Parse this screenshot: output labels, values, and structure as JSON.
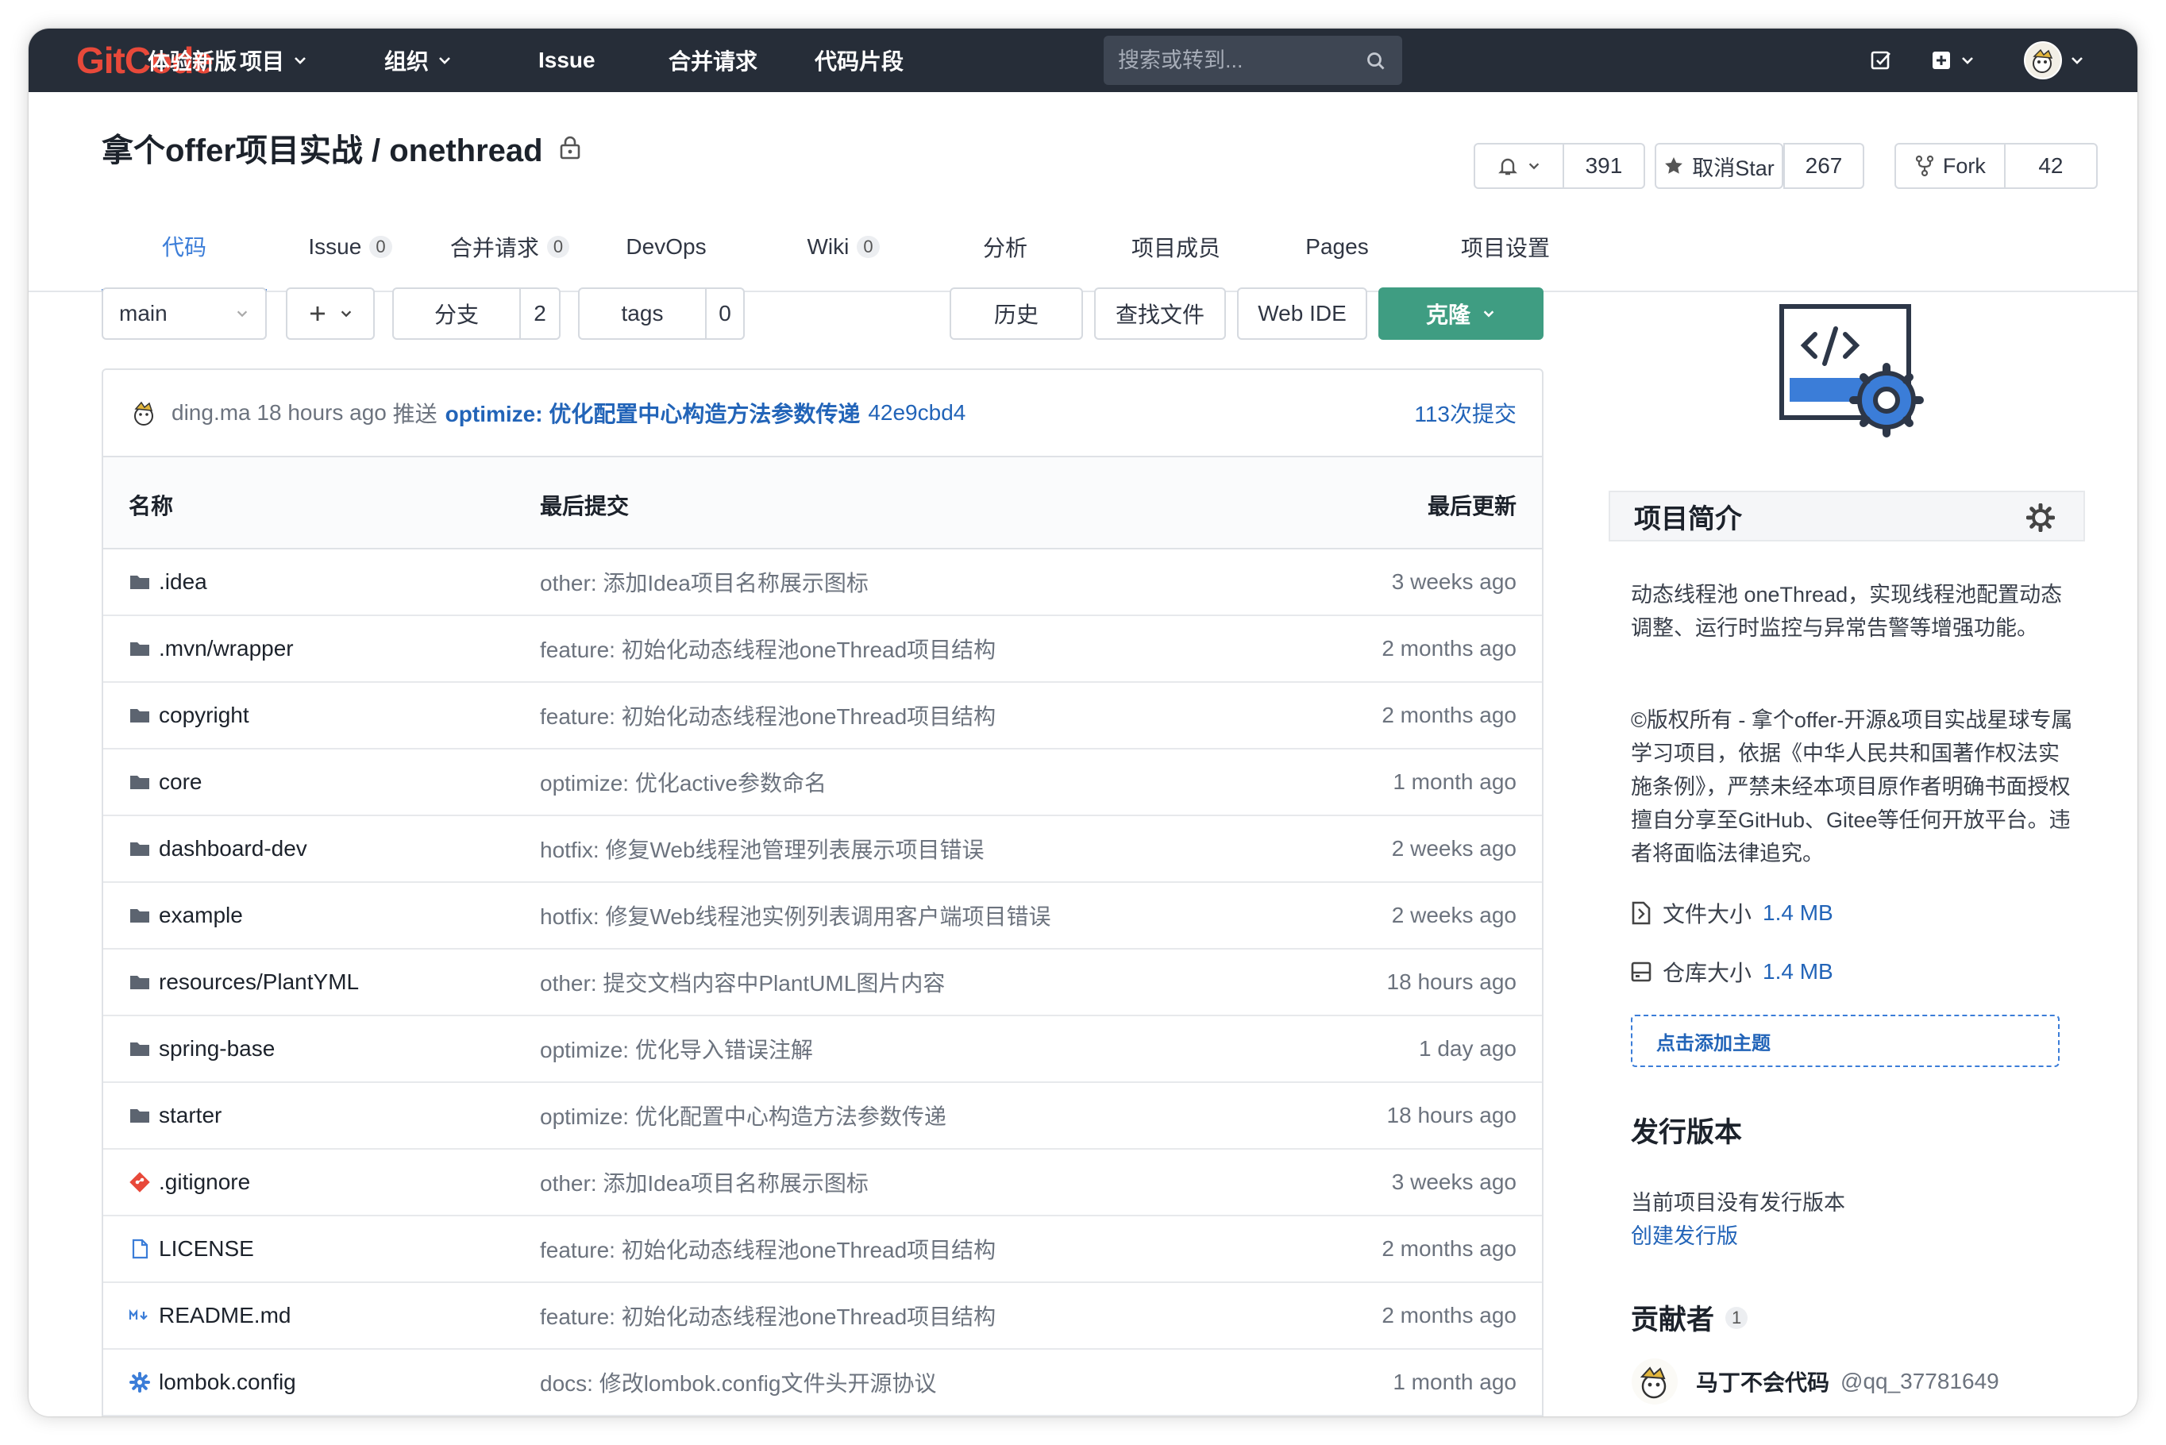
{
  "nav": {
    "logo_text": "GitCode",
    "items": [
      "体验新版",
      "项目",
      "组织",
      "Issue",
      "合并请求",
      "代码片段"
    ],
    "search_placeholder": "搜索或转到..."
  },
  "repo": {
    "namespace": "拿个offer项目实战",
    "separator": " / ",
    "name": "onethread",
    "watch_count": "391",
    "star_label": "取消Star",
    "star_count": "267",
    "fork_label": "Fork",
    "fork_count": "42"
  },
  "tabs": [
    {
      "label": "代码",
      "badge": ""
    },
    {
      "label": "Issue",
      "badge": "0"
    },
    {
      "label": "合并请求",
      "badge": "0"
    },
    {
      "label": "DevOps",
      "badge": ""
    },
    {
      "label": "Wiki",
      "badge": "0"
    },
    {
      "label": "分析",
      "badge": ""
    },
    {
      "label": "项目成员",
      "badge": ""
    },
    {
      "label": "Pages",
      "badge": ""
    },
    {
      "label": "项目设置",
      "badge": ""
    }
  ],
  "toolbar": {
    "branch": "main",
    "branches_label": "分支",
    "branches_count": "2",
    "tags_label": "tags",
    "tags_count": "0",
    "history": "历史",
    "find_file": "查找文件",
    "web_ide": "Web IDE",
    "clone": "克隆"
  },
  "last_commit": {
    "author": "ding.ma",
    "time": "18 hours ago",
    "action": "推送",
    "message": "optimize: 优化配置中心构造方法参数传递",
    "sha": "42e9cbd4",
    "commit_count": "113次提交"
  },
  "table": {
    "headers": {
      "name": "名称",
      "last_commit": "最后提交",
      "last_update": "最后更新"
    },
    "rows": [
      {
        "name": ".idea",
        "type": "folder",
        "commit": "other: 添加Idea项目名称展示图标",
        "time": "3 weeks ago"
      },
      {
        "name": ".mvn/wrapper",
        "type": "folder",
        "commit": "feature: 初始化动态线程池oneThread项目结构",
        "time": "2 months ago"
      },
      {
        "name": "copyright",
        "type": "folder",
        "commit": "feature: 初始化动态线程池oneThread项目结构",
        "time": "2 months ago"
      },
      {
        "name": "core",
        "type": "folder",
        "commit": "optimize: 优化active参数命名",
        "time": "1 month ago"
      },
      {
        "name": "dashboard-dev",
        "type": "folder",
        "commit": "hotfix: 修复Web线程池管理列表展示项目错误",
        "time": "2 weeks ago"
      },
      {
        "name": "example",
        "type": "folder",
        "commit": "hotfix: 修复Web线程池实例列表调用客户端项目错误",
        "time": "2 weeks ago"
      },
      {
        "name": "resources/PlantYML",
        "type": "folder",
        "commit": "other: 提交文档内容中PlantUML图片内容",
        "time": "18 hours ago"
      },
      {
        "name": "spring-base",
        "type": "folder",
        "commit": "optimize: 优化导入错误注解",
        "time": "1 day ago"
      },
      {
        "name": "starter",
        "type": "folder",
        "commit": "optimize: 优化配置中心构造方法参数传递",
        "time": "18 hours ago"
      },
      {
        "name": ".gitignore",
        "type": "git",
        "commit": "other: 添加Idea项目名称展示图标",
        "time": "3 weeks ago"
      },
      {
        "name": "LICENSE",
        "type": "file",
        "commit": "feature: 初始化动态线程池oneThread项目结构",
        "time": "2 months ago"
      },
      {
        "name": "README.md",
        "type": "markdown",
        "commit": "feature: 初始化动态线程池oneThread项目结构",
        "time": "2 months ago"
      },
      {
        "name": "lombok.config",
        "type": "config",
        "commit": "docs: 修改lombok.config文件头开源协议",
        "time": "1 month ago"
      }
    ]
  },
  "sidebar": {
    "about_title": "项目简介",
    "description": "动态线程池 oneThread，实现线程池配置动态调整、运行时监控与异常告警等增强功能。",
    "copyright": "©版权所有 - 拿个offer-开源&项目实战星球专属学习项目，依据《中华人民共和国著作权法实施条例》，严禁未经本项目原作者明确书面授权擅自分享至GitHub、Gitee等任何开放平台。违者将面临法律追究。",
    "file_size_label": "文件大小",
    "file_size": "1.4 MB",
    "repo_size_label": "仓库大小",
    "repo_size": "1.4 MB",
    "add_topic": "点击添加主题",
    "releases_title": "发行版本",
    "no_releases": "当前项目没有发行版本",
    "create_release": "创建发行版",
    "contributors_title": "贡献者",
    "contributors_count": "1",
    "contributor_name": "马丁不会代码",
    "contributor_handle": "@qq_37781649"
  },
  "colors": {
    "nav_bg": "#262d38",
    "accent": "#3b7dd8",
    "clone_green": "#3f9d82",
    "logo_red": "#e8493a"
  }
}
